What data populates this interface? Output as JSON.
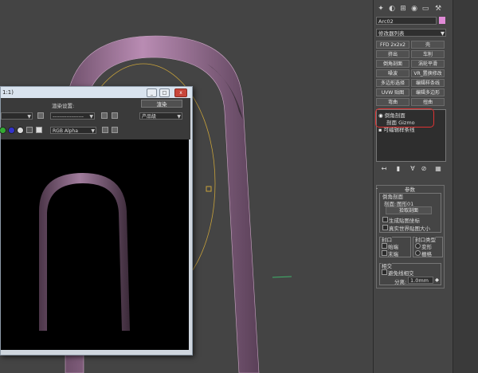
{
  "render_window": {
    "title": "1:1)",
    "title_buttons": [
      "_",
      "□",
      "x"
    ],
    "area_label": "渲染设置:",
    "area_value": "------------------",
    "render_button": "渲染",
    "preset_value": "产品级",
    "channel_value": "RGB Alpha"
  },
  "panel": {
    "object_name": "Arc02",
    "modifier_list": "修改器列表",
    "modifier_buttons": [
      "FFD 2x2x2",
      "壳",
      "挤出",
      "车削",
      "倒角剖面",
      "涡轮平滑",
      "噪波",
      "VR_置换修改",
      "多边形选择",
      "编辑样条线",
      "UVW 贴图",
      "编辑多边形",
      "弯曲",
      "扭曲"
    ],
    "stack_items": [
      "倒角剖面",
      "剖面 Gizmo",
      "可编辑样条线"
    ],
    "params": {
      "header": "参数",
      "bevel_profile_label": "倒角剖面",
      "profile_label": "剖面:",
      "profile_value": "图形01",
      "pick_profile": "拾取剖面",
      "gen_mapping": "生成贴图坐标",
      "real_world": "真实世界贴图大小",
      "capping_group": "封口",
      "cap_start": "始端",
      "cap_end": "末端",
      "cap_type_group": "封口类型",
      "morph": "变形",
      "grid": "栅格",
      "intersect_group": "相交",
      "avoid_intersect": "避免线相交",
      "separation_label": "分离:",
      "separation_value": "1.0mm"
    }
  },
  "colors": {
    "arch_pink": "#b98cb3",
    "highlight_red": "#d33333",
    "gizmo_yellow": "#c8a23a"
  }
}
